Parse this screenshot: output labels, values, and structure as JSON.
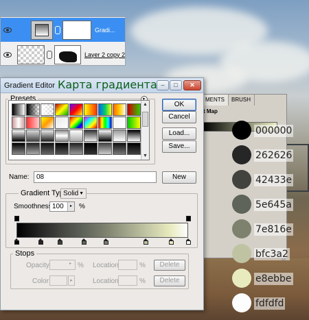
{
  "layers": [
    {
      "name": "Gradi...",
      "selected": true
    },
    {
      "name": "Layer 2 copy 2",
      "selected": false
    }
  ],
  "dialog": {
    "window_title": "Gradient Editor",
    "overlay_title": "Карта градиента",
    "presets_label": "Presets",
    "buttons": {
      "ok": "OK",
      "cancel": "Cancel",
      "load": "Load...",
      "save": "Save...",
      "new": "New"
    },
    "name_label": "Name:",
    "name_value": "08",
    "gradient_type_label": "Gradient Type:",
    "gradient_type_value": "Solid",
    "smoothness_label": "Smoothness:",
    "smoothness_value": "100",
    "percent": "%",
    "stops": {
      "label": "Stops",
      "opacity_label": "Opacity:",
      "color_label": "Color:",
      "location_label": "Location:",
      "delete_label": "Delete"
    }
  },
  "bg_panel": {
    "tab1": "MENTS",
    "tab2": "BRUSH",
    "title": "t Map"
  },
  "gradient_stop_positions": [
    0,
    0.14,
    0.25,
    0.39,
    0.52,
    0.75,
    0.9,
    1.0
  ],
  "palette": [
    {
      "hex": "000000",
      "color": "#000000"
    },
    {
      "hex": "262626",
      "color": "#262626"
    },
    {
      "hex": "42433e",
      "color": "#42433e"
    },
    {
      "hex": "5e645a",
      "color": "#5e645a"
    },
    {
      "hex": "7e816e",
      "color": "#7e816e"
    },
    {
      "hex": "bfc3a2",
      "color": "#bfc3a2"
    },
    {
      "hex": "e8ebbe",
      "color": "#e8ebbe"
    },
    {
      "hex": "fdfdfd",
      "color": "#fdfdfd"
    }
  ],
  "preset_swatches": [
    "linear-gradient(90deg,#000,#fff)",
    "linear-gradient(90deg,#000,transparent)",
    "linear-gradient(90deg,#fff,transparent)",
    "linear-gradient(135deg,#c40000,#ff0,#0a0)",
    "linear-gradient(135deg,#60f,#f00,#ff0)",
    "linear-gradient(90deg,#ff0,#f30)",
    "linear-gradient(90deg,#06f,#0c6,#ff0)",
    "linear-gradient(90deg,#f60,#fc0,#fff)",
    "linear-gradient(90deg,#c00,#3c0)",
    "linear-gradient(90deg,#c99,#fff,#c99)",
    "linear-gradient(90deg,#f33,#fcc)",
    "linear-gradient(135deg,#ff0,#f90,#fff)",
    "linear-gradient(135deg,#e8e8e8,#fff)",
    "linear-gradient(135deg,#f00,#f90,#ff0,#0f0,#00f,#90f)",
    "linear-gradient(135deg,#f0f,#0ff,#ff0,#f00)",
    "linear-gradient(90deg,#f00,#ff0,#0f0,#0ff,#00f)",
    "linear-gradient(135deg,#f5f5f5,#fff)",
    "linear-gradient(90deg,#0c0,#ff0)",
    "linear-gradient(180deg,#fff,#000)",
    "linear-gradient(180deg,#ddd,#444)",
    "linear-gradient(180deg,#eee,#222)",
    "linear-gradient(180deg,#888,#fff,#888)",
    "linear-gradient(180deg,#fff,#aaa)",
    "linear-gradient(180deg,#333,#eee)",
    "linear-gradient(180deg,#fff,#000)",
    "linear-gradient(180deg,#999,#fff)",
    "linear-gradient(180deg,#000,#fff)",
    "linear-gradient(180deg,#000,#888)",
    "linear-gradient(180deg,#222,#aaa)",
    "linear-gradient(180deg,#111,#666)",
    "linear-gradient(180deg,#000,#555)",
    "linear-gradient(180deg,#222,#999)",
    "linear-gradient(180deg,#000,#333)",
    "linear-gradient(180deg,#444,#ccc)",
    "linear-gradient(180deg,#111,#777)",
    "linear-gradient(180deg,#000,#444)"
  ]
}
